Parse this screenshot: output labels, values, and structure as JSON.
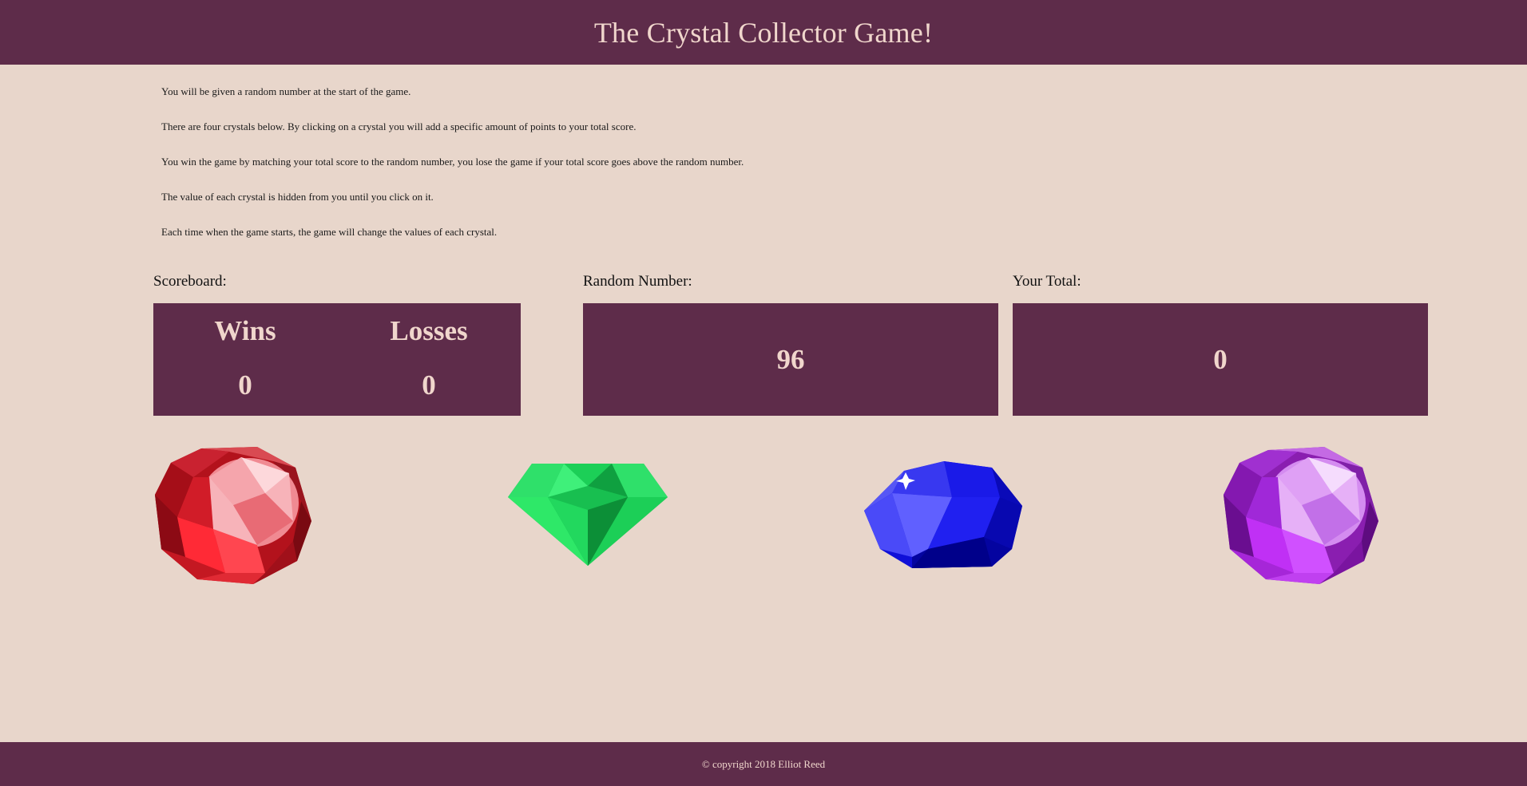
{
  "header": {
    "title": "The Crystal Collector Game!"
  },
  "instructions": [
    "You will be given a random number at the start of the game.",
    "There are four crystals below. By clicking on a crystal you will add a specific amount of points to your total score.",
    "You win the game by matching your total score to the random number, you lose the game if your total score goes above the random number.",
    "The value of each crystal is hidden from you until you click on it.",
    "Each time when the game starts, the game will change the values of each crystal."
  ],
  "scoreboard": {
    "label": "Scoreboard:",
    "wins_label": "Wins",
    "losses_label": "Losses",
    "wins": "0",
    "losses": "0"
  },
  "random_number": {
    "label": "Random Number:",
    "value": "96"
  },
  "total": {
    "label": "Your Total:",
    "value": "0"
  },
  "crystals": [
    {
      "name": "red-crystal-icon",
      "color": "#e0202c"
    },
    {
      "name": "green-crystal-icon",
      "color": "#1ed15a"
    },
    {
      "name": "blue-crystal-icon",
      "color": "#1a1ae8"
    },
    {
      "name": "purple-crystal-icon",
      "color": "#b236e0"
    }
  ],
  "colors": {
    "accent": "#5e2c4a",
    "background": "#e8d6cb",
    "accent_text": "#f0d6cc"
  },
  "footer": {
    "text": "© copyright 2018 Elliot Reed"
  }
}
